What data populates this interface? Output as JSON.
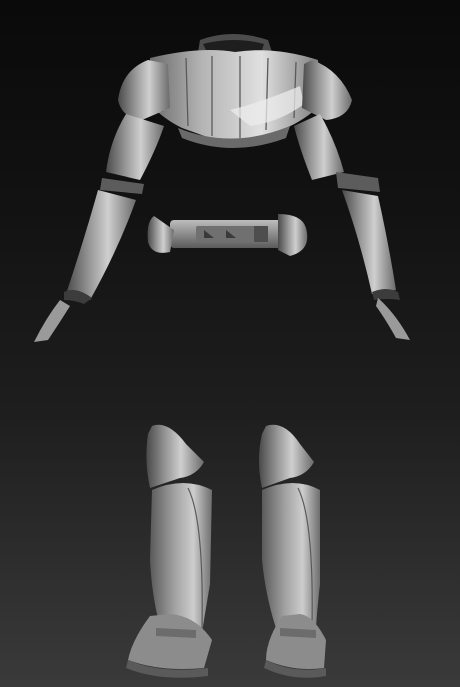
{
  "scene": {
    "background": {
      "top": "#0a0a0a",
      "bottom": "#3a3a3a"
    },
    "material_color": "#8e8e8e",
    "highlight_color": "#d8d8d8",
    "shadow_color": "#3c3c3c",
    "parts": [
      "chest-armor",
      "left-arm-armor",
      "right-arm-armor",
      "belt",
      "left-leg-armor",
      "right-leg-armor"
    ]
  }
}
